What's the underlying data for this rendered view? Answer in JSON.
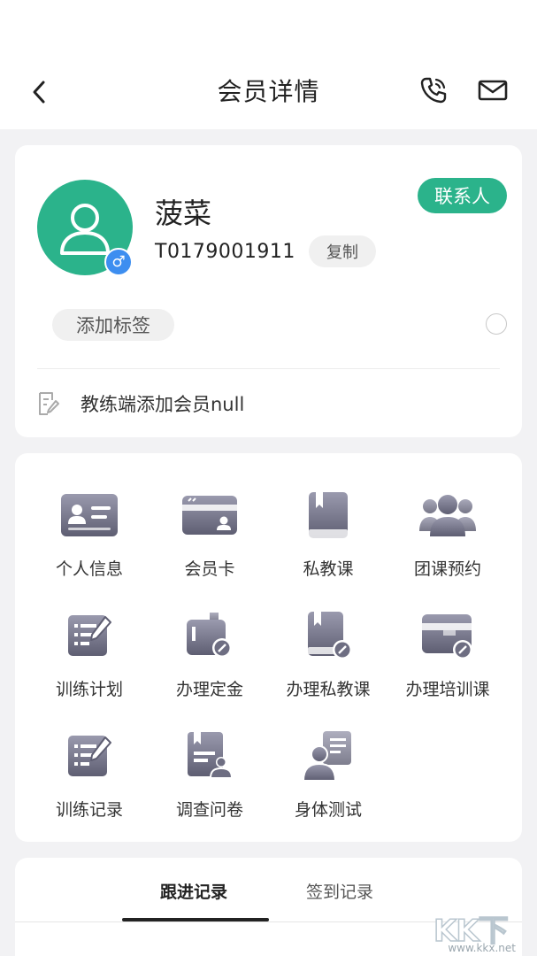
{
  "header": {
    "title": "会员详情",
    "back_icon": "chevron-left-icon",
    "phone_icon": "phone-icon",
    "mail_icon": "mail-icon"
  },
  "member": {
    "name": "菠菜",
    "id": "T0179001911",
    "gender_symbol": "♂",
    "copy_label": "复制",
    "contact_label": "联系人",
    "add_tag_label": "添加标签",
    "note": "教练端添加会员null"
  },
  "functions": [
    {
      "label": "个人信息",
      "icon": "id-card-icon"
    },
    {
      "label": "会员卡",
      "icon": "member-card-icon"
    },
    {
      "label": "私教课",
      "icon": "book-icon"
    },
    {
      "label": "团课预约",
      "icon": "group-icon"
    },
    {
      "label": "训练计划",
      "icon": "plan-edit-icon"
    },
    {
      "label": "办理定金",
      "icon": "deposit-icon"
    },
    {
      "label": "办理私教课",
      "icon": "book-edit-icon"
    },
    {
      "label": "办理培训课",
      "icon": "training-card-icon"
    },
    {
      "label": "训练记录",
      "icon": "record-edit-icon"
    },
    {
      "label": "调查问卷",
      "icon": "survey-icon"
    },
    {
      "label": "身体测试",
      "icon": "body-test-icon"
    }
  ],
  "tabs": [
    {
      "label": "跟进记录",
      "active": true
    },
    {
      "label": "签到记录",
      "active": false
    }
  ],
  "watermark": {
    "text": "KK下载",
    "url": "www.kkx.net"
  },
  "colors": {
    "accent": "#2bb38b",
    "gender": "#3d8ef0",
    "icon": "#7a7a90"
  }
}
